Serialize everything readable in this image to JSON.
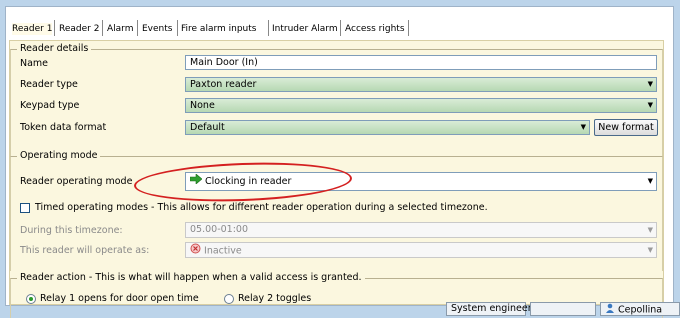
{
  "tabs": [
    "Reader 1",
    "Reader 2",
    "Alarm",
    "Events",
    "Fire alarm inputs",
    "Intruder Alarm",
    "Access rights"
  ],
  "reader_details": {
    "legend": "Reader details",
    "name_label": "Name",
    "name_value": "Main Door (In)",
    "reader_type_label": "Reader type",
    "reader_type_value": "Paxton reader",
    "keypad_type_label": "Keypad type",
    "keypad_type_value": "None",
    "token_format_label": "Token data format",
    "token_format_value": "Default",
    "new_format_button": "New format"
  },
  "operating_mode": {
    "legend": "Operating mode",
    "reader_mode_label": "Reader operating mode",
    "reader_mode_value": "Clocking in reader",
    "timed_modes_label": "Timed operating modes - This allows for different reader operation during a selected timezone.",
    "during_label": "During this timezone:",
    "during_value": "05.00-01:00",
    "will_operate_label": "This reader will operate as:",
    "will_operate_value": "Inactive"
  },
  "reader_action": {
    "legend": "Reader action - This is what will happen when a valid access is granted.",
    "option1": "Relay 1 opens for door open time",
    "option2": "Relay 2 toggles"
  },
  "statusbar": {
    "role": "System engineer",
    "user": "Cepollina"
  },
  "colors": {
    "highlight_ellipse": "#d42020",
    "panel_bg": "#fbf7df",
    "select_bg": "#c6e2c2",
    "page_bg": "#bcd4ea"
  }
}
